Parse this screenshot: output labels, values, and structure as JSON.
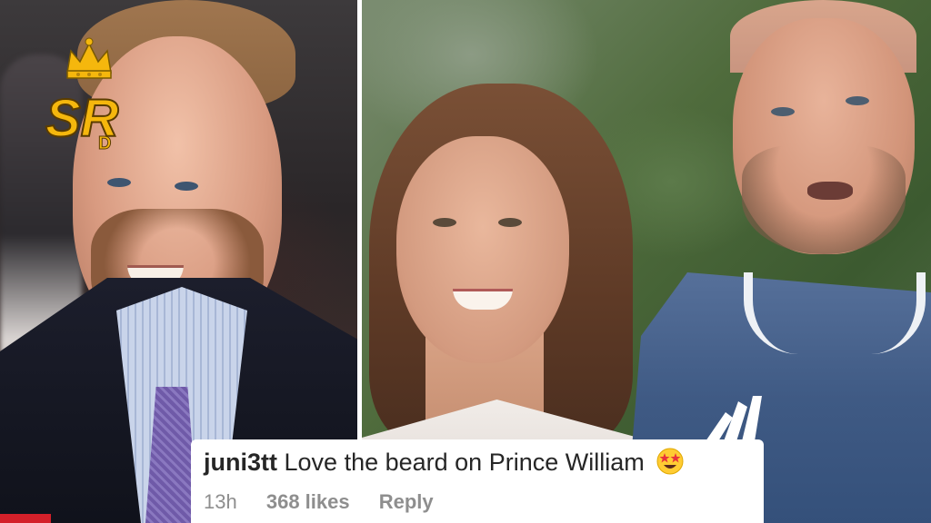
{
  "logo": {
    "text": "SR",
    "sub": "D",
    "icon": "crown-icon",
    "color": "#f5b70d"
  },
  "comment": {
    "username": "juni3tt",
    "text": "Love the beard on Prince William",
    "emoji": "star-struck-emoji",
    "time": "13h",
    "likes": "368 likes",
    "reply": "Reply"
  },
  "colors": {
    "badge": "#d4202a",
    "comment_bg": "#ffffff"
  }
}
